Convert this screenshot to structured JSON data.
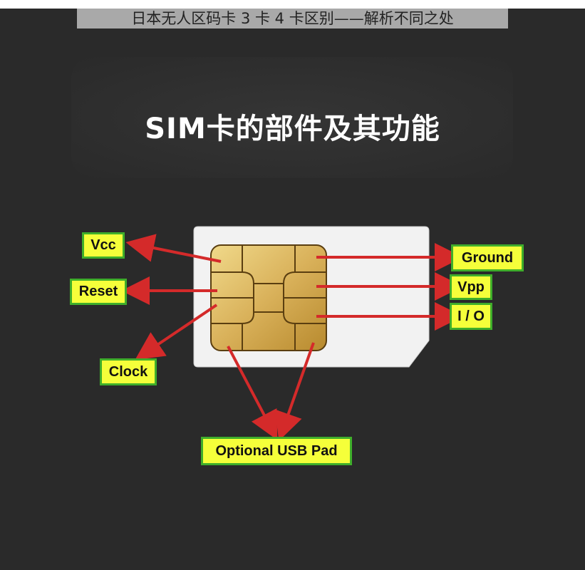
{
  "caption": "日本无人区码卡 3 卡 4 卡区别——解析不同之处",
  "title": "SIM卡的部件及其功能",
  "colors": {
    "background": "#2a2a2a",
    "label_fill": "#f5ff3a",
    "label_border": "#3fae2a",
    "arrow": "#d42a2a",
    "chip_gold": "#d9b15a",
    "card": "#f2f2f2"
  },
  "labels": {
    "vcc": "Vcc",
    "reset": "Reset",
    "clock": "Clock",
    "ground": "Ground",
    "vpp": "Vpp",
    "io": "I / O",
    "usb": "Optional USB Pad"
  }
}
